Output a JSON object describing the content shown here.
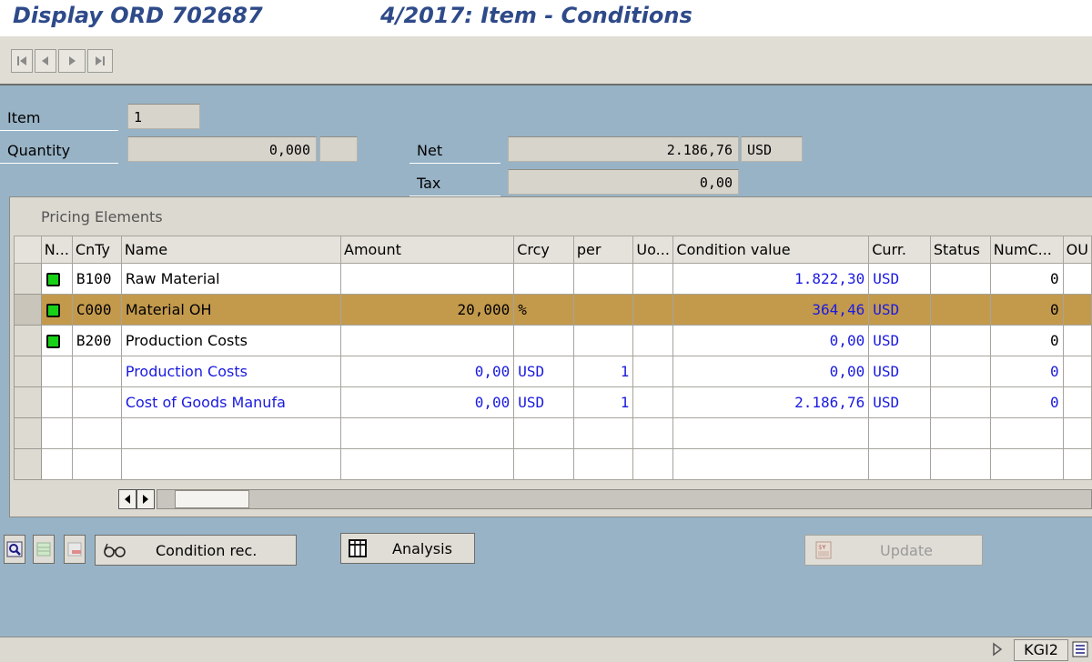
{
  "title": {
    "document": "Display ORD 702687",
    "screen": "4/2017: Item - Conditions"
  },
  "toolbar": {
    "nav_buttons": [
      "first-page-icon",
      "previous-page-icon",
      "next-page-icon",
      "last-page-icon"
    ]
  },
  "header": {
    "item_label": "Item",
    "item_value": "1",
    "quantity_label": "Quantity",
    "quantity_value": "0,000",
    "quantity_unit": "",
    "net_label": "Net",
    "net_value": "2.186,76",
    "net_currency": "USD",
    "tax_label": "Tax",
    "tax_value": "0,00"
  },
  "pricing": {
    "title": "Pricing Elements",
    "columns": [
      "N...",
      "CnTy",
      "Name",
      "Amount",
      "Crcy",
      "per",
      "Uo...",
      "Condition value",
      "Curr.",
      "Status",
      "NumC...",
      "OU"
    ],
    "rows": [
      {
        "n": "green-square-icon",
        "cnty": "B100",
        "name": "Raw Material",
        "amount": "",
        "crcy": "",
        "per": "",
        "uom": "",
        "condition_value": "1.822,30",
        "curr": "USD",
        "status": "",
        "numc": "0",
        "ou": ""
      },
      {
        "n": "green-square-icon",
        "cnty": "C000",
        "name": "Material OH",
        "amount": "20,000",
        "crcy": "%",
        "per": "",
        "uom": "",
        "condition_value": "364,46",
        "curr": "USD",
        "status": "",
        "numc": "0",
        "ou": ""
      },
      {
        "n": "green-square-icon",
        "cnty": "B200",
        "name": "Production Costs",
        "amount": "",
        "crcy": "",
        "per": "",
        "uom": "",
        "condition_value": "0,00",
        "curr": "USD",
        "status": "",
        "numc": "0",
        "ou": ""
      },
      {
        "n": "",
        "cnty": "",
        "name": "Production Costs",
        "amount": "0,00",
        "crcy": "USD",
        "per": "1",
        "uom": "",
        "condition_value": "0,00",
        "curr": "USD",
        "status": "",
        "numc": "0",
        "ou": ""
      },
      {
        "n": "",
        "cnty": "",
        "name": "Cost of Goods Manufa",
        "amount": "0,00",
        "crcy": "USD",
        "per": "1",
        "uom": "",
        "condition_value": "2.186,76",
        "curr": "USD",
        "status": "",
        "numc": "0",
        "ou": ""
      }
    ],
    "selected_row": "Material OH"
  },
  "buttons": {
    "condition_rec": "Condition rec.",
    "analysis": "Analysis",
    "update": "Update"
  },
  "statusbar": {
    "transaction": "KGI2"
  },
  "colors": {
    "background": "#98b3c6",
    "title_text": "#2e4a89",
    "highlight_row": "#c39a4c",
    "subtotal_text": "#1a1ae0",
    "status_led": "#17d117"
  }
}
